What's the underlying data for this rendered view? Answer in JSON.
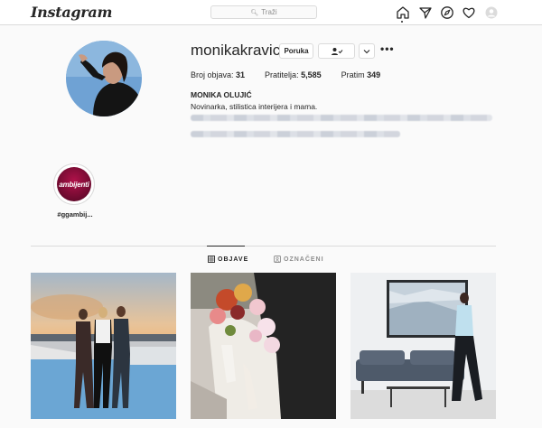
{
  "topnav": {
    "logo": "Instagram",
    "search_placeholder": "Traži",
    "icons": [
      "home-icon",
      "direct-icon",
      "explore-icon",
      "activity-icon",
      "profile-avatar"
    ]
  },
  "profile": {
    "username": "monikakravic",
    "message_button": "Poruka",
    "follow_icon": "person-check-icon",
    "suggest_icon": "chevron-down-icon",
    "more_label": "•••",
    "stats": [
      {
        "label": "Broj objava: ",
        "value": "31"
      },
      {
        "label": "Pratitelja: ",
        "value": "5,585"
      },
      {
        "label": "Pratim ",
        "value": "349"
      }
    ],
    "full_name": "MONIKA OLUJIĆ",
    "bio": "Novinarka, stilistica interijera i mama."
  },
  "highlight": {
    "cover_text": "ambijenti",
    "label": "#ggambij..."
  },
  "tabs": [
    {
      "label": "OBJAVE",
      "icon": "grid-icon",
      "active": true
    },
    {
      "label": "OZNAČENI",
      "icon": "tag-icon",
      "active": false
    }
  ],
  "posts": [
    "sunset-group-photo",
    "bridal-bouquet-photo",
    "interior-sofa-photo"
  ],
  "colors": {
    "border": "#dbdbdb",
    "text": "#262626",
    "muted": "#8e8e8e",
    "background": "#fafafa"
  }
}
